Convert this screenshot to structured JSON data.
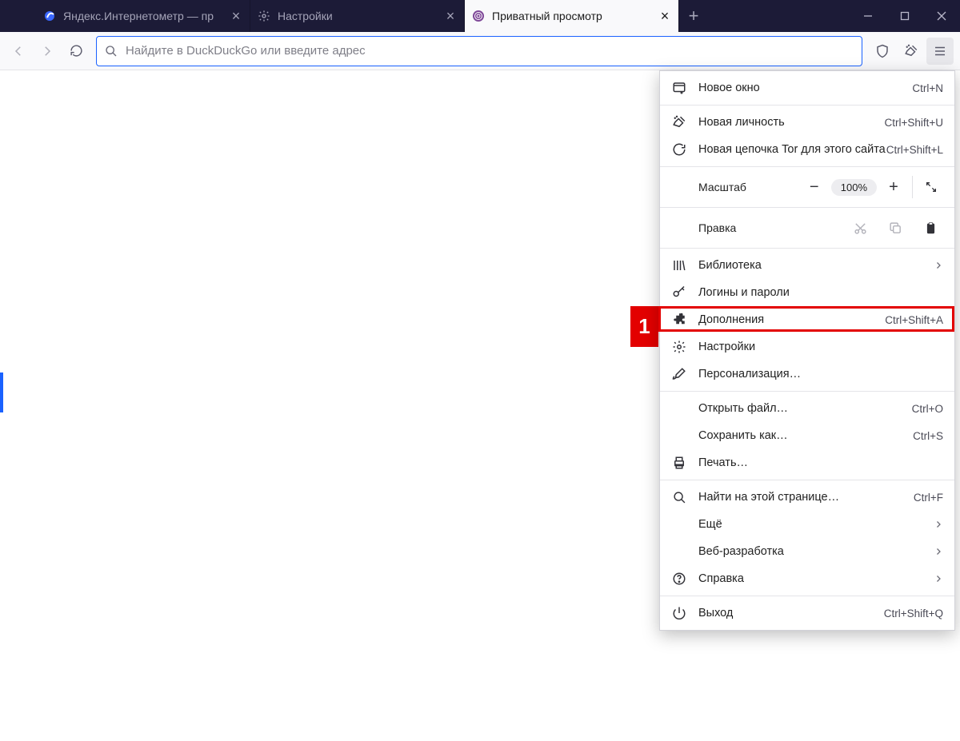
{
  "tabs": [
    {
      "label": "Яндекс.Интернетометр — пр"
    },
    {
      "label": "Настройки"
    },
    {
      "label": "Приватный просмотр"
    }
  ],
  "urlbar": {
    "placeholder": "Найдите в DuckDuckGo или введите адрес"
  },
  "zoom": {
    "label": "Масштаб",
    "value": "100%"
  },
  "edit": {
    "label": "Правка"
  },
  "menu": {
    "new_window": {
      "label": "Новое окно",
      "short": "Ctrl+N"
    },
    "new_identity": {
      "label": "Новая личность",
      "short": "Ctrl+Shift+U"
    },
    "new_circuit": {
      "label": "Новая цепочка Tor для этого сайта",
      "short": "Ctrl+Shift+L"
    },
    "library": {
      "label": "Библиотека"
    },
    "logins": {
      "label": "Логины и пароли"
    },
    "addons": {
      "label": "Дополнения",
      "short": "Ctrl+Shift+A"
    },
    "settings": {
      "label": "Настройки"
    },
    "customize": {
      "label": "Персонализация…"
    },
    "open_file": {
      "label": "Открыть файл…",
      "short": "Ctrl+O"
    },
    "save_as": {
      "label": "Сохранить как…",
      "short": "Ctrl+S"
    },
    "print": {
      "label": "Печать…"
    },
    "find": {
      "label": "Найти на этой странице…",
      "short": "Ctrl+F"
    },
    "more": {
      "label": "Ещё"
    },
    "webdev": {
      "label": "Веб-разработка"
    },
    "help": {
      "label": "Справка"
    },
    "quit": {
      "label": "Выход",
      "short": "Ctrl+Shift+Q"
    }
  },
  "callout": {
    "num": "1"
  }
}
